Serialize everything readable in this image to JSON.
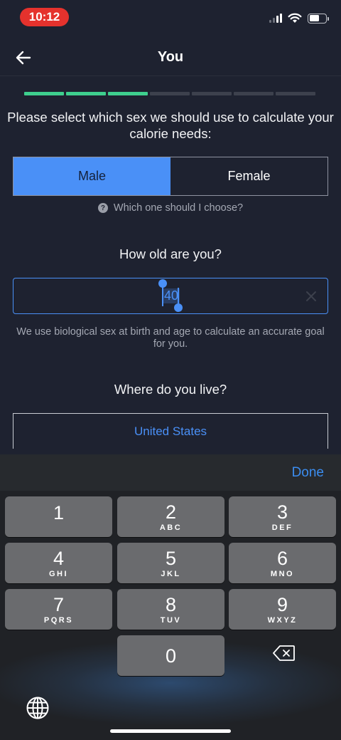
{
  "status_bar": {
    "time": "10:12",
    "signal_bars": 4,
    "signal_bars_filled": 2,
    "battery_level": 0.6
  },
  "nav": {
    "title": "You",
    "back_icon": "arrow-left-icon"
  },
  "progress": {
    "total_steps": 7,
    "completed_steps": 3,
    "done_color": "#3ecf8e"
  },
  "sex_section": {
    "question": "Please select which sex we should use to calculate your calorie needs:",
    "options": [
      "Male",
      "Female"
    ],
    "selected": "Male",
    "help_link": "Which one should I choose?"
  },
  "age_section": {
    "question": "How old are you?",
    "value": "40",
    "note": "We use biological sex at birth and age to calculate an accurate goal for you."
  },
  "country_section": {
    "question": "Where do you live?",
    "value": "United States"
  },
  "keyboard": {
    "done_label": "Done",
    "keys": [
      {
        "num": "1",
        "letters": ""
      },
      {
        "num": "2",
        "letters": "ABC"
      },
      {
        "num": "3",
        "letters": "DEF"
      },
      {
        "num": "4",
        "letters": "GHI"
      },
      {
        "num": "5",
        "letters": "JKL"
      },
      {
        "num": "6",
        "letters": "MNO"
      },
      {
        "num": "7",
        "letters": "PQRS"
      },
      {
        "num": "8",
        "letters": "TUV"
      },
      {
        "num": "9",
        "letters": "WXYZ"
      },
      {
        "num": "0",
        "letters": ""
      }
    ]
  },
  "colors": {
    "accent": "#4a90f7",
    "background": "#1e2230"
  }
}
